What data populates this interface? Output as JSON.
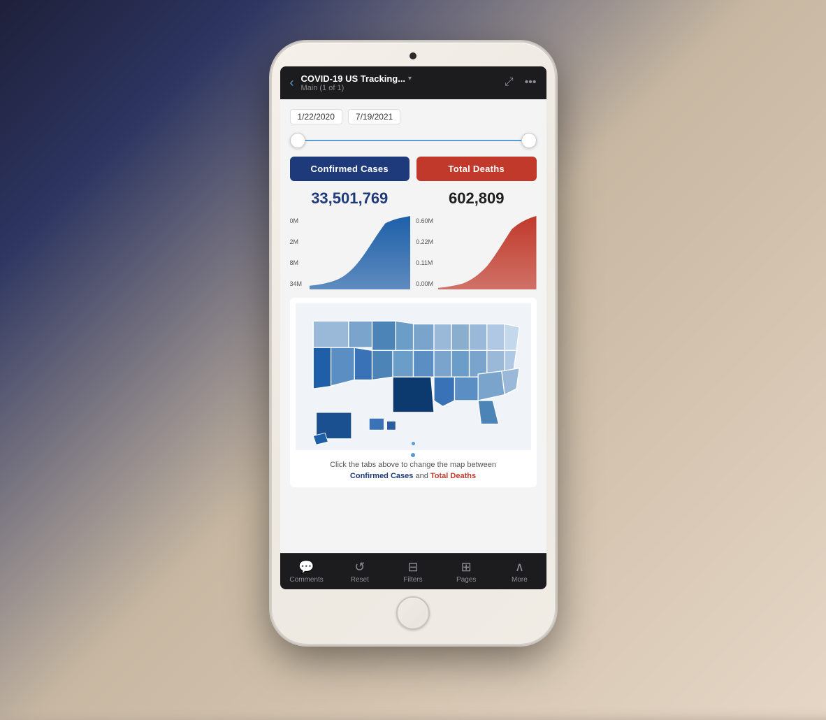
{
  "header": {
    "title": "COVID-19 US Tracking...",
    "subtitle": "Main (1 of 1)",
    "back_label": "‹",
    "expand_icon": "⤢",
    "more_icon": "•••"
  },
  "dateRange": {
    "start": "1/22/2020",
    "end": "7/19/2021"
  },
  "stats": {
    "confirmed_label": "Confirmed Cases",
    "confirmed_value": "33,501,769",
    "deaths_label": "Total Deaths",
    "deaths_value": "602,809"
  },
  "charts": {
    "confirmed": {
      "labels": [
        "0M",
        "2M",
        "8M",
        "34M"
      ],
      "color": "#1e5fa8"
    },
    "deaths": {
      "labels": [
        "0.00M",
        "0.11M",
        "0.22M",
        "0.60M"
      ],
      "color": "#c0392b"
    }
  },
  "map": {
    "instruction_prefix": "Click the tabs above to change the map between",
    "confirmed_link": "Confirmed Cases",
    "and_text": "and",
    "deaths_link": "Total Deaths"
  },
  "toolbar": {
    "items": [
      {
        "icon": "💬",
        "label": "Comments"
      },
      {
        "icon": "↺",
        "label": "Reset"
      },
      {
        "icon": "⊟",
        "label": "Filters"
      },
      {
        "icon": "⊞",
        "label": "Pages"
      },
      {
        "icon": "∧",
        "label": "More"
      }
    ]
  }
}
